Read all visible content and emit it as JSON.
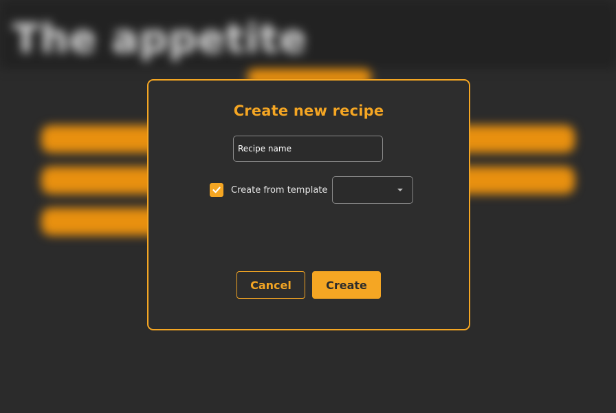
{
  "background": {
    "app_title": "The appetite"
  },
  "dialog": {
    "title": "Create new recipe",
    "name_field": {
      "placeholder": "Recipe name",
      "value": ""
    },
    "template_checkbox": {
      "label": "Create from template",
      "checked": true
    },
    "template_select": {
      "selected": "",
      "icon": "chevron-down-icon"
    },
    "cancel_label": "Cancel",
    "create_label": "Create"
  },
  "colors": {
    "accent": "#f5a623",
    "background": "#2b2b2b",
    "dialog_background": "#2d2d2d"
  }
}
